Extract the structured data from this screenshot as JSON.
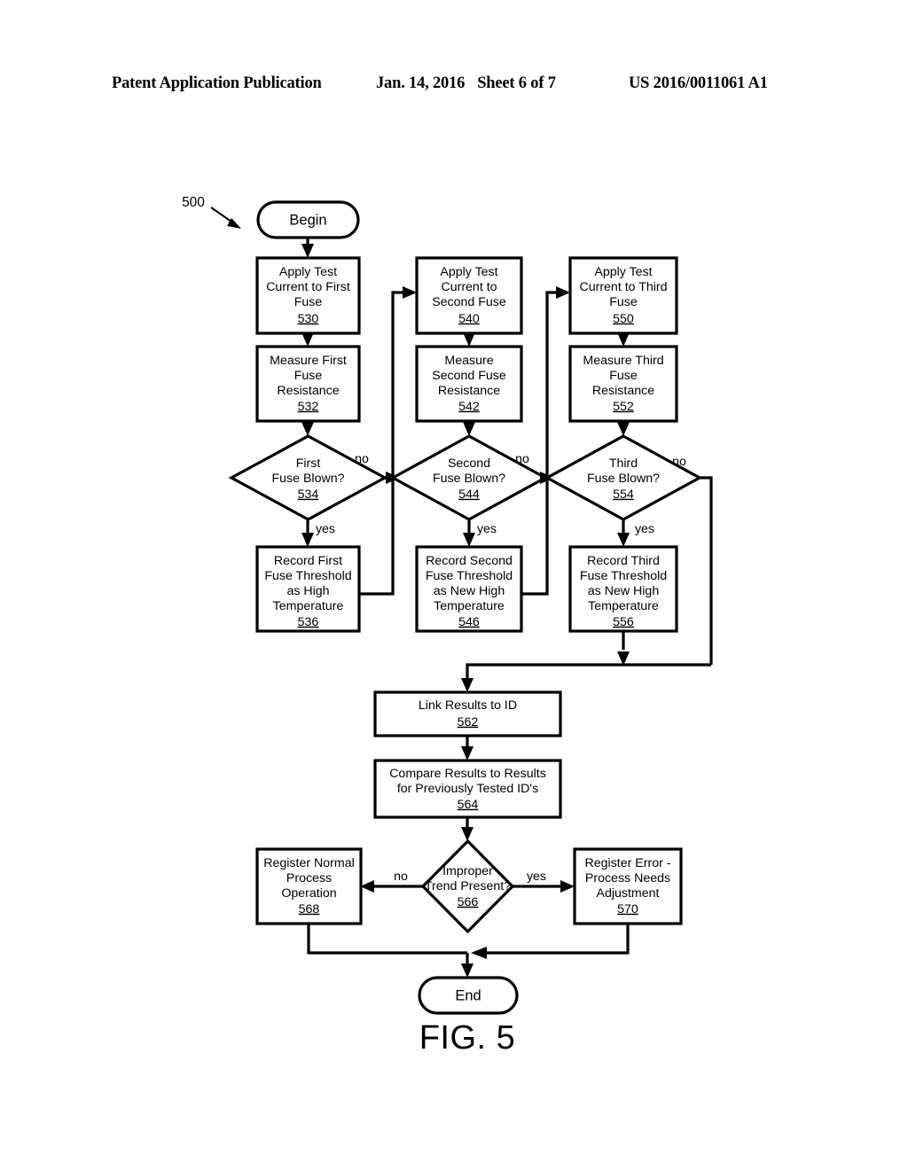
{
  "header": {
    "left": "Patent Application Publication",
    "date": "Jan. 14, 2016",
    "sheet": "Sheet 6 of 7",
    "publication_number": "US 2016/0011061 A1"
  },
  "figure": {
    "caption": "FIG. 5",
    "diagram_ref": "500"
  },
  "nodes": {
    "begin": {
      "label": "Begin"
    },
    "end": {
      "label": "End"
    },
    "n530": {
      "lines": [
        "Apply Test",
        "Current to First",
        "Fuse"
      ],
      "ref": "530"
    },
    "n532": {
      "lines": [
        "Measure First",
        "Fuse",
        "Resistance"
      ],
      "ref": "532"
    },
    "n534": {
      "lines": [
        "First",
        "Fuse Blown?"
      ],
      "ref": "534"
    },
    "n536": {
      "lines": [
        "Record First",
        "Fuse Threshold",
        "as High",
        "Temperature"
      ],
      "ref": "536"
    },
    "n540": {
      "lines": [
        "Apply Test",
        "Current to",
        "Second Fuse"
      ],
      "ref": "540"
    },
    "n542": {
      "lines": [
        "Measure",
        "Second Fuse",
        "Resistance"
      ],
      "ref": "542"
    },
    "n544": {
      "lines": [
        "Second",
        "Fuse Blown?"
      ],
      "ref": "544"
    },
    "n546": {
      "lines": [
        "Record Second",
        "Fuse Threshold",
        "as New High",
        "Temperature"
      ],
      "ref": "546"
    },
    "n550": {
      "lines": [
        "Apply Test",
        "Current to Third",
        "Fuse"
      ],
      "ref": "550"
    },
    "n552": {
      "lines": [
        "Measure Third",
        "Fuse",
        "Resistance"
      ],
      "ref": "552"
    },
    "n554": {
      "lines": [
        "Third",
        "Fuse Blown?"
      ],
      "ref": "554"
    },
    "n556": {
      "lines": [
        "Record Third",
        "Fuse Threshold",
        "as New High",
        "Temperature"
      ],
      "ref": "556"
    },
    "n562": {
      "lines": [
        "Link Results to ID"
      ],
      "ref": "562"
    },
    "n564": {
      "lines": [
        "Compare Results to Results",
        "for Previously Tested ID's"
      ],
      "ref": "564"
    },
    "n566": {
      "lines": [
        "Improper",
        "Trend Present?"
      ],
      "ref": "566"
    },
    "n568": {
      "lines": [
        "Register Normal",
        "Process",
        "Operation"
      ],
      "ref": "568"
    },
    "n570": {
      "lines": [
        "Register Error -",
        "Process Needs",
        "Adjustment"
      ],
      "ref": "570"
    }
  },
  "edge_labels": {
    "no_534": "no",
    "yes_534": "yes",
    "no_544": "no",
    "yes_544": "yes",
    "no_554": "no",
    "yes_554": "yes",
    "no_566": "no",
    "yes_566": "yes"
  },
  "colors": {
    "ink": "#000000",
    "paper": "#ffffff"
  }
}
